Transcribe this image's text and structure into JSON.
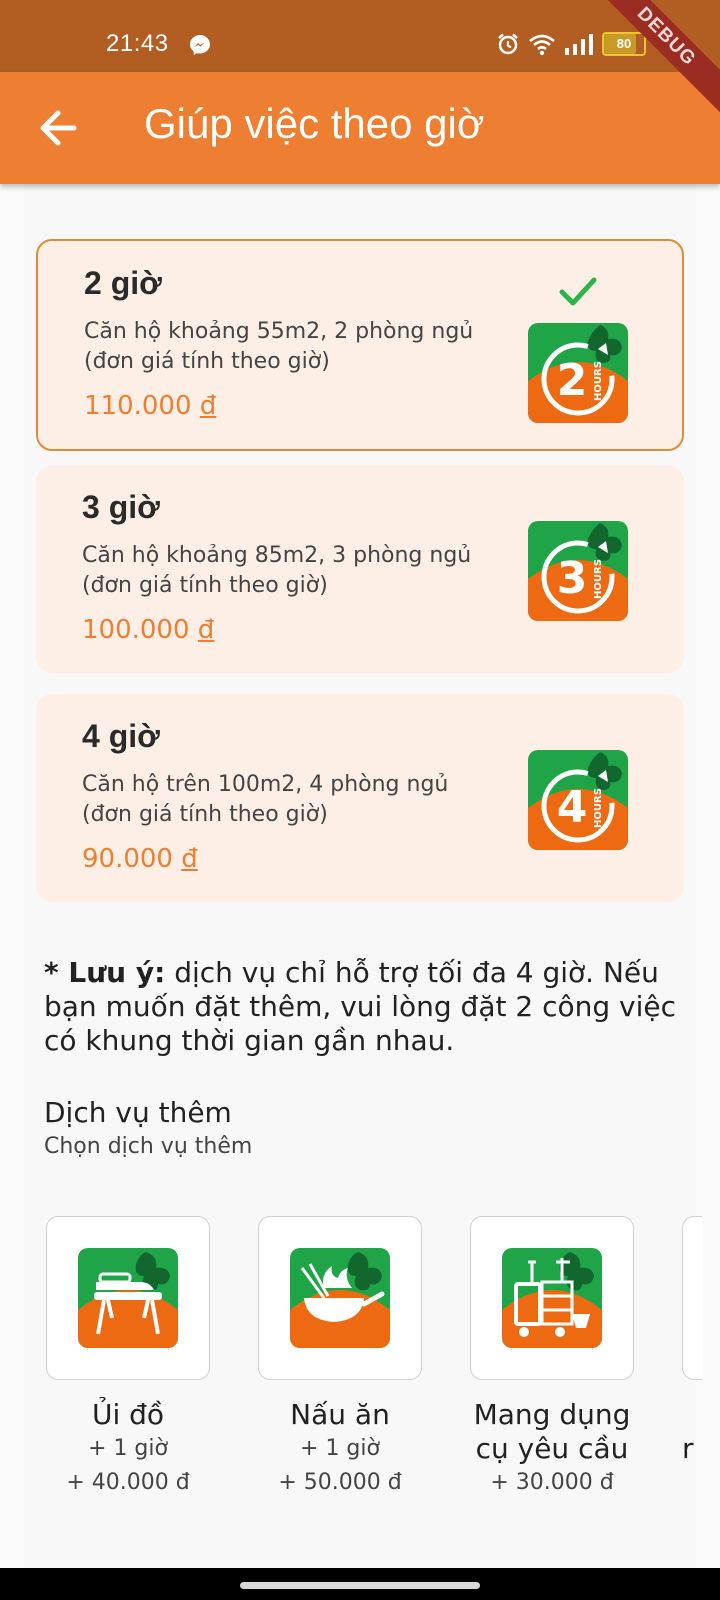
{
  "status": {
    "time": "21:43",
    "battery": "80",
    "battery_level": 0.8,
    "debug": "DEBUG"
  },
  "app_bar": {
    "title": "Giúp việc theo giờ"
  },
  "packages": [
    {
      "title": "2 giờ",
      "desc": "Căn hộ khoảng 55m2, 2 phòng ngủ (đơn giá tính theo giờ)",
      "price": "110.000",
      "currency": "đ",
      "icon_number": "2",
      "selected": true
    },
    {
      "title": "3 giờ",
      "desc": "Căn hộ khoảng 85m2, 3 phòng ngủ (đơn giá tính theo giờ)",
      "price": "100.000",
      "currency": "đ",
      "icon_number": "3",
      "selected": false
    },
    {
      "title": "4 giờ",
      "desc": "Căn hộ trên 100m2, 4 phòng ngủ (đơn giá tính theo giờ)",
      "price": "90.000",
      "currency": "đ",
      "icon_number": "4",
      "selected": false
    }
  ],
  "icon_text": "HOURS",
  "note": {
    "label": "* Lưu ý:",
    "text": " dịch vụ chỉ hỗ trợ tối đa 4 giờ. Nếu bạn muốn đặt thêm, vui lòng đặt 2 công việc có khung thời gian gần nhau."
  },
  "extras": {
    "title": "Dịch vụ thêm",
    "subtitle": "Chọn dịch vụ thêm",
    "items": [
      {
        "name": "Ủi đồ",
        "time": "+ 1 giờ",
        "price": "+ 40.000 đ"
      },
      {
        "name": "Nấu ăn",
        "time": "+ 1 giờ",
        "price": "+ 50.000 đ"
      },
      {
        "name": "Mang dụng cụ yêu cầu",
        "time": "",
        "price": "+ 30.000 đ"
      },
      {
        "name": "r",
        "time": "",
        "price": ""
      }
    ]
  },
  "colors": {
    "status_bar": "#b25e23",
    "app_bar": "#ee7e31",
    "card_bg": "#fdefe6",
    "accent": "#ee7e31",
    "icon_green": "#1fa547",
    "icon_orange": "#ee6a12",
    "check_green": "#2db34a"
  }
}
